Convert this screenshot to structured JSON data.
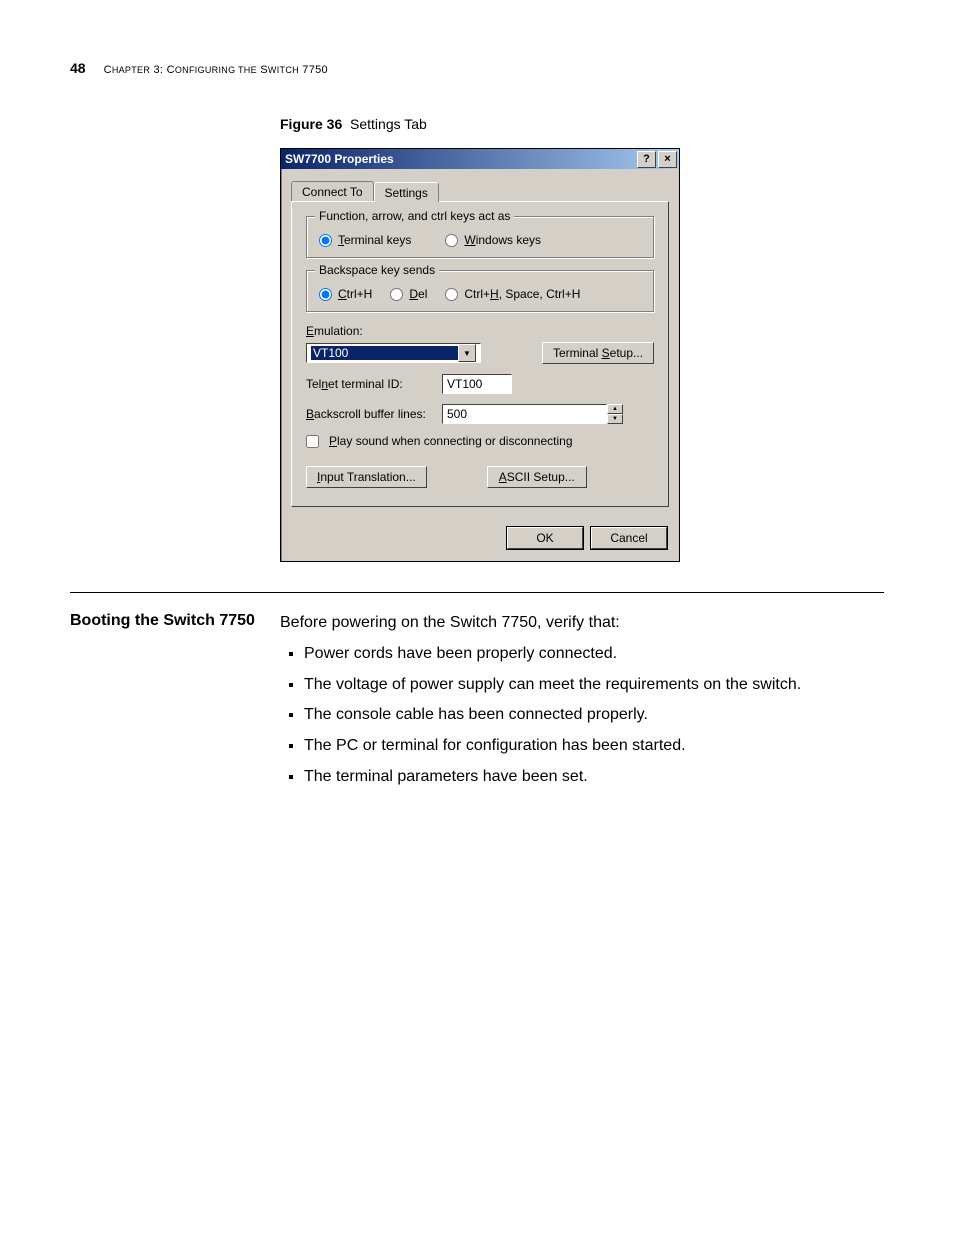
{
  "header": {
    "page_number": "48",
    "chapter_label": "Chapter 3: Configuring the Switch 7750"
  },
  "figure": {
    "label": "Figure 36",
    "title": "Settings Tab"
  },
  "dialog": {
    "title": "SW7700 Properties",
    "help_btn": "?",
    "close_btn": "×",
    "tabs": {
      "connect": "Connect To",
      "settings": "Settings"
    },
    "group1": {
      "legend": "Function, arrow, and ctrl keys act as",
      "opt_terminal": "Terminal keys",
      "opt_windows": "Windows keys"
    },
    "group2": {
      "legend": "Backspace key sends",
      "opt_ctrlh": "Ctrl+H",
      "opt_del": "Del",
      "opt_space": "Ctrl+H, Space, Ctrl+H"
    },
    "emulation_label": "Emulation:",
    "emulation_value": "VT100",
    "terminal_setup_btn": "Terminal Setup...",
    "telnet_label": "Telnet terminal ID:",
    "telnet_value": "VT100",
    "backscroll_label": "Backscroll buffer lines:",
    "backscroll_value": "500",
    "play_sound_label": "Play sound when connecting or disconnecting",
    "input_translation_btn": "Input Translation...",
    "ascii_setup_btn": "ASCII Setup...",
    "ok_btn": "OK",
    "cancel_btn": "Cancel"
  },
  "section": {
    "heading": "Booting the Switch 7750",
    "intro": "Before powering on the Switch 7750, verify that:",
    "bullets": [
      "Power cords have been properly connected.",
      "The voltage of power supply can meet the requirements on the switch.",
      "The console cable has been connected properly.",
      "The PC or terminal for configuration has been started.",
      "The terminal parameters have been set."
    ]
  }
}
